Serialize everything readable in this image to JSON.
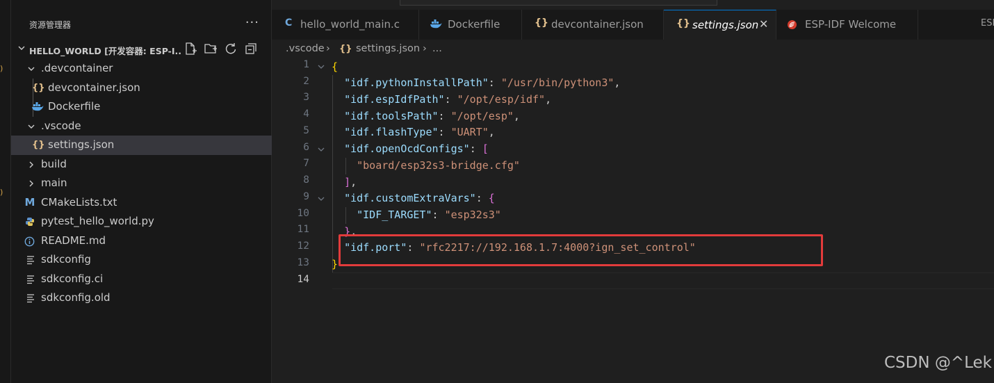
{
  "sidebar": {
    "title": "资源管理器",
    "more_label": "···",
    "project_title": "HELLO_WORLD [开发容器: ESP-I...",
    "items": [
      {
        "label": ".devcontainer",
        "icon": "chevron-down-icon",
        "type": "folder-open"
      },
      {
        "label": "devcontainer.json",
        "icon": "json-braces-icon",
        "type": "file"
      },
      {
        "label": "Dockerfile",
        "icon": "docker-icon",
        "type": "file"
      },
      {
        "label": ".vscode",
        "icon": "chevron-down-icon",
        "type": "folder-open"
      },
      {
        "label": "settings.json",
        "icon": "json-braces-icon",
        "type": "file"
      },
      {
        "label": "build",
        "icon": "chevron-right-icon",
        "type": "folder"
      },
      {
        "label": "main",
        "icon": "chevron-right-icon",
        "type": "folder"
      },
      {
        "label": "CMakeLists.txt",
        "icon": "cmake-m-icon",
        "type": "file"
      },
      {
        "label": "pytest_hello_world.py",
        "icon": "python-icon",
        "type": "file"
      },
      {
        "label": "README.md",
        "icon": "info-icon",
        "type": "file"
      },
      {
        "label": "sdkconfig",
        "icon": "lines-icon",
        "type": "file"
      },
      {
        "label": "sdkconfig.ci",
        "icon": "lines-icon",
        "type": "file"
      },
      {
        "label": "sdkconfig.old",
        "icon": "lines-icon",
        "type": "file"
      }
    ]
  },
  "tabs": [
    {
      "label": "hello_world_main.c",
      "icon": "c-icon"
    },
    {
      "label": "Dockerfile",
      "icon": "docker-icon"
    },
    {
      "label": "devcontainer.json",
      "icon": "json-braces-icon"
    },
    {
      "label": "settings.json",
      "icon": "json-braces-icon",
      "active": true,
      "close": "✕"
    },
    {
      "label": "ESP-IDF Welcome",
      "icon": "esp-idf-icon"
    },
    {
      "label": "ESP",
      "icon": ""
    }
  ],
  "breadcrumb": {
    "folder": ".vscode",
    "sep1": "›",
    "file": "settings.json",
    "sep2": "›",
    "tail": "..."
  },
  "editor": {
    "line_numbers": [
      "1",
      "2",
      "3",
      "4",
      "5",
      "6",
      "7",
      "8",
      "9",
      "10",
      "11",
      "12",
      "13",
      "14"
    ],
    "lines": {
      "l1": "{",
      "l2_key": "\"idf.pythonInstallPath\"",
      "l2_val": "\"/usr/bin/python3\"",
      "l3_key": "\"idf.espIdfPath\"",
      "l3_val": "\"/opt/esp/idf\"",
      "l4_key": "\"idf.toolsPath\"",
      "l4_val": "\"/opt/esp\"",
      "l5_key": "\"idf.flashType\"",
      "l5_val": "\"UART\"",
      "l6_key": "\"idf.openOcdConfigs\"",
      "l6_open": "[",
      "l7_val": "\"board/esp32s3-bridge.cfg\"",
      "l8_close": "]",
      "l9_key": "\"idf.customExtraVars\"",
      "l9_open": "{",
      "l10_key": "\"IDF_TARGET\"",
      "l10_val": "\"esp32s3\"",
      "l11_close": "}",
      "l12_key": "\"idf.port\"",
      "l12_val": "\"rfc2217://192.168.1.7:4000?ign_set_control\"",
      "l13": "}"
    },
    "colon": ": ",
    "comma": ","
  },
  "watermark": "CSDN @^Lek",
  "colors": {
    "highlight_box": "#e23b3b",
    "accent": "#0078d4",
    "json_icon": "#e2c08d",
    "string": "#ce9178",
    "key": "#9cdcfe"
  }
}
